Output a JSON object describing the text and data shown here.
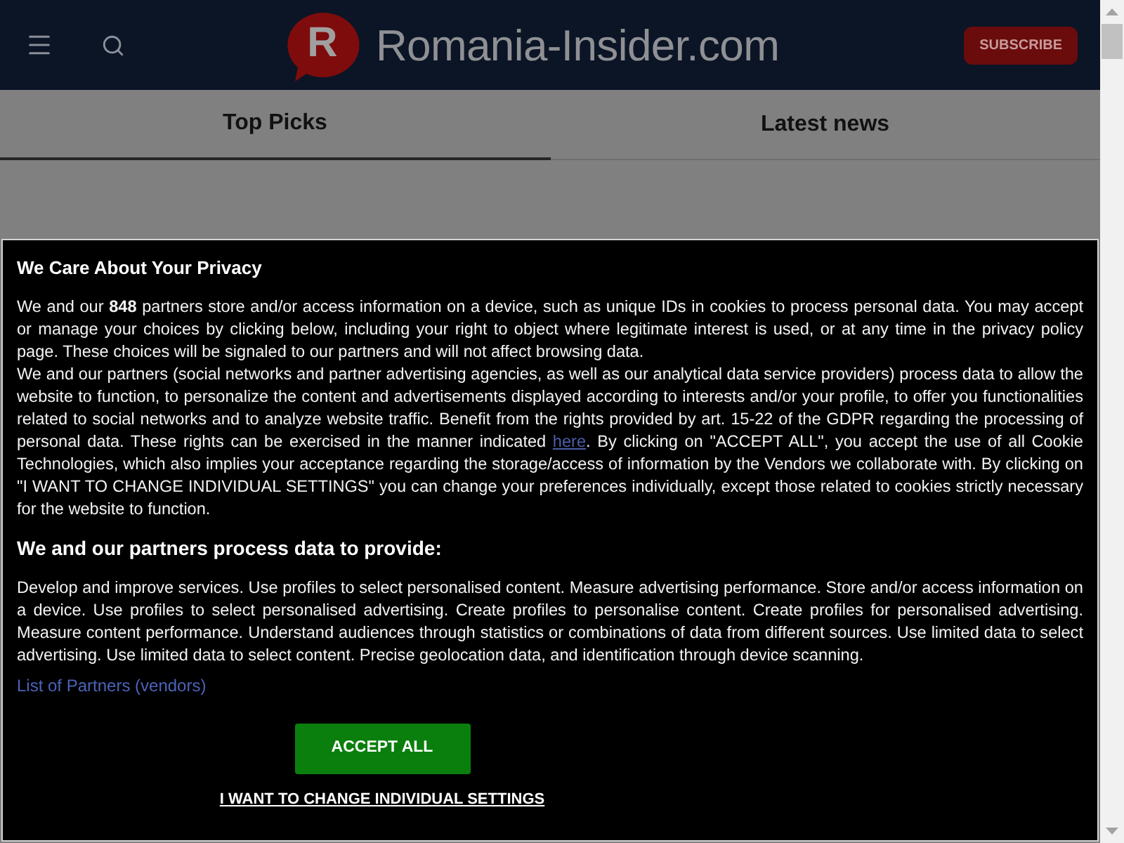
{
  "header": {
    "logo_letter": "R",
    "logo_text": "Romania-Insider.com",
    "subscribe_button": "SUBSCRIBE"
  },
  "tabs": [
    {
      "label": "Top Picks",
      "selected": true
    },
    {
      "label": "Latest news",
      "selected": false
    }
  ],
  "consent_dialog": {
    "title": "We Care About Your Privacy",
    "intro": "We and our **848** partners store and/or access information on a device, such as unique IDs in cookies to process personal data. You may accept or manage your choices by clicking below, including your right to object where legitimate interest is used, or at any time in the privacy policy page. These choices will be signaled to our partners and will not affect browsing data.",
    "details": {
      "before_link": "We and our partners (social networks and partner advertising agencies, as well as our analytical data service providers) process data to allow the website to function, to personalize the content and advertisements displayed according to interests and/or your profile, to offer you functionalities related to social networks and to analyze website traffic. Benefit from the rights provided by art. 15-22 of the GDPR regarding the processing of personal data. These rights can be exercised in the manner indicated ",
      "link": "here",
      "after_link": ". By clicking on \"ACCEPT ALL\", you accept the use of all Cookie Technologies, which also implies your acceptance regarding the storage/access of information by the Vendors we collaborate with. By clicking on \"I WANT TO CHANGE INDIVIDUAL SETTINGS\" you can change your preferences individually, except those related to cookies strictly necessary for the website to function."
    },
    "purposes_heading": "We and our partners process data to provide:",
    "purposes": "Develop and improve services. Use profiles to select personalised content. Measure advertising performance. Store and/or access information on a device. Use profiles to select personalised advertising. Create profiles to personalise content. Create profiles for personalised advertising. Measure content performance. Understand audiences through statistics or combinations of data from different sources. Use limited data to select advertising. Use limited data to select content. Precise geolocation data, and identification through device scanning.",
    "partners_link": "List of Partners (vendors)",
    "accept_button": "ACCEPT ALL",
    "settings_link": "I WANT TO CHANGE INDIVIDUAL SETTINGS"
  }
}
